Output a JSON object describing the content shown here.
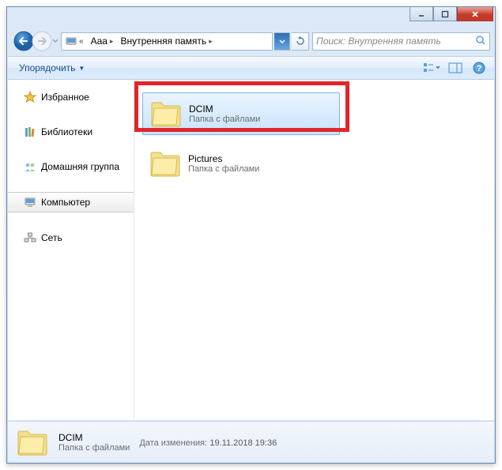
{
  "titlebar": {},
  "nav": {
    "breadcrumbs": [
      {
        "label": "Aaa"
      },
      {
        "label": "Внутренняя память"
      }
    ],
    "search_placeholder": "Поиск: Внутренняя память"
  },
  "toolbar": {
    "organize_label": "Упорядочить"
  },
  "sidebar": {
    "favorites": "Избранное",
    "libraries": "Библиотеки",
    "homegroup": "Домашняя группа",
    "computer": "Компьютер",
    "network": "Сеть"
  },
  "folders": [
    {
      "name": "DCIM",
      "subtitle": "Папка с файлами",
      "selected": true
    },
    {
      "name": "Pictures",
      "subtitle": "Папка с файлами",
      "selected": false
    }
  ],
  "details": {
    "name": "DCIM",
    "subtitle": "Папка с файлами",
    "modified_label": "Дата изменения:",
    "modified_value": "19.11.2018 19:36"
  }
}
